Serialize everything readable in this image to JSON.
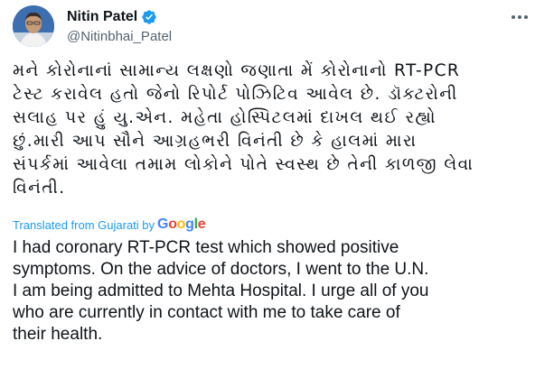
{
  "header": {
    "display_name": "Nitin Patel",
    "handle": "@Nitinbhai_Patel",
    "verified": true
  },
  "icons": {
    "avatar": "profile-photo",
    "verified": "verified-badge-icon",
    "more": "more-options-icon"
  },
  "tweet": {
    "original_text": "મને કોરોનાનાં સામાન્ય લક્ષણો જણાતા મેં કોરોનાનો RT-PCR\nટેસ્ટ કરાવેલ હતો જેનો રિપોર્ટ પોઝિટિવ આવેલ છે. ડૉક્ટરોની\nસલાહ પર હું યુ.એન. મહેતા હોસ્પિટલમાં દાખલ થઈ રહ્યો\nછું.મારી આપ સૌને આગ્રહભરી વિનંતી છે કે હાલમાં મારા\nસંપર્કમાં આવેલા તમામ લોકોને પોતે સ્વસ્થ છે તેની કાળજી લેવા\nવિનંતી.",
    "translated_label": "Translated from Gujarati by",
    "translated_text": "I had coronary RT-PCR test which showed positive\nsymptoms. On the advice of doctors, I went to the U.N.\nI am being admitted to Mehta Hospital. I urge all of you\nwho are currently in contact with me to take care of\ntheir health."
  },
  "google_logo": {
    "text": "Google",
    "letter_colors": [
      "#4285F4",
      "#EA4335",
      "#FBBC05",
      "#4285F4",
      "#34A853",
      "#EA4335"
    ]
  },
  "colors": {
    "accent": "#1d9bf0",
    "text": "#0f1419",
    "secondary": "#536471"
  }
}
